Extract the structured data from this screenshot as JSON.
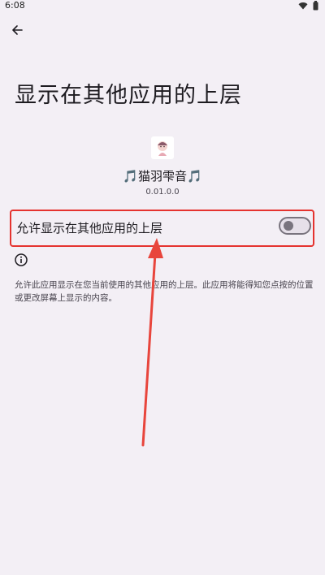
{
  "status_bar": {
    "time": "6:08"
  },
  "page": {
    "title": "显示在其他应用的上层"
  },
  "app": {
    "name": "🎵猫羽雫音🎵",
    "version": "0.01.0.0"
  },
  "permission": {
    "toggle_label": "允许显示在其他应用的上层",
    "toggle_on": false,
    "description": "允许此应用显示在您当前使用的其他应用的上层。此应用将能得知您点按的位置或更改屏幕上显示的内容。"
  },
  "colors": {
    "background": "#f3eff5",
    "highlight_border": "#e5332f",
    "annotation_arrow": "#e8453c"
  },
  "icons": {
    "back": "arrow-left-icon",
    "info": "info-icon",
    "wifi": "wifi-icon",
    "battery": "battery-icon"
  }
}
